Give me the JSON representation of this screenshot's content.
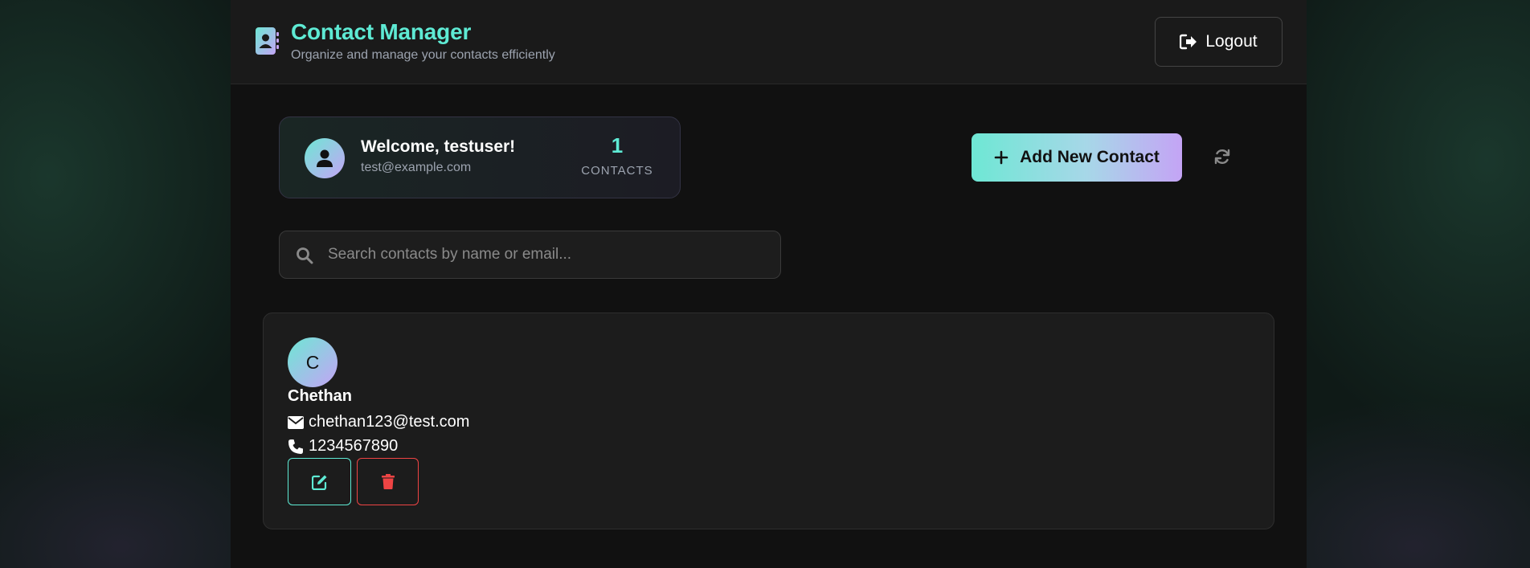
{
  "header": {
    "title": "Contact Manager",
    "subtitle": "Organize and manage your contacts efficiently",
    "logout_label": "Logout"
  },
  "welcome": {
    "greeting": "Welcome, testuser!",
    "email": "test@example.com",
    "contact_count": "1",
    "contact_count_label": "CONTACTS"
  },
  "actions": {
    "add_label": "Add New Contact"
  },
  "search": {
    "placeholder": "Search contacts by name or email..."
  },
  "contacts": [
    {
      "initial": "C",
      "name": "Chethan",
      "email": "chethan123@test.com",
      "phone": "1234567890"
    }
  ],
  "colors": {
    "accent_teal": "#5eead4",
    "accent_purple": "#c4a4f5",
    "danger": "#ef4444",
    "background": "#111111"
  }
}
